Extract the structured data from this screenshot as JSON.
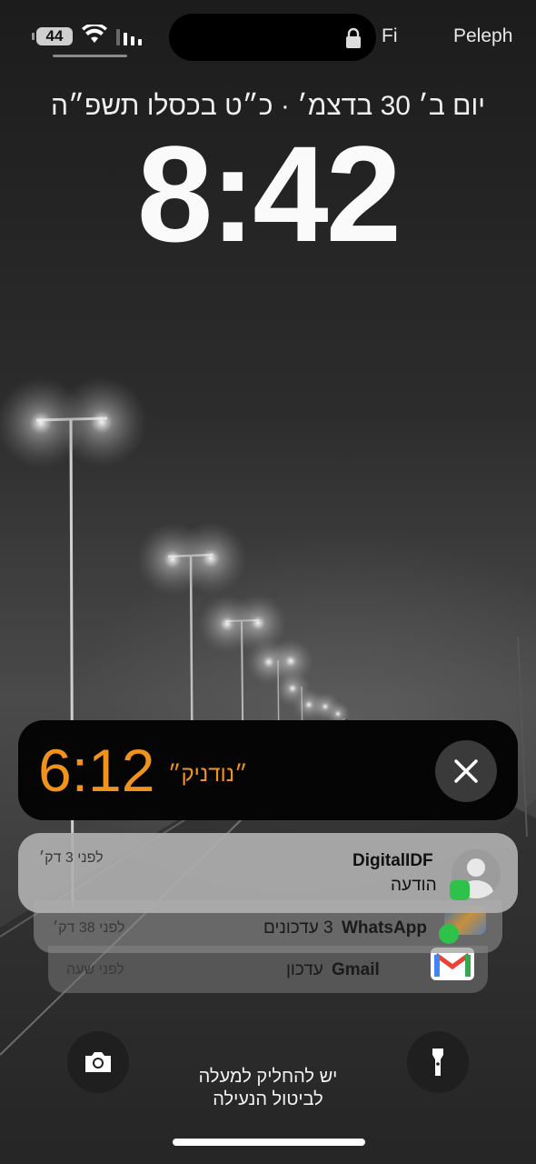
{
  "status_bar": {
    "battery": "44",
    "wifi_label": "Fi",
    "carrier": "Peleph"
  },
  "lock_screen": {
    "date": "יום ב׳ 30 בדצמ׳ · כ״ט בכסלו תשפ״ה",
    "time": "8:42"
  },
  "timer_activity": {
    "remaining": "6:12",
    "label": "״נודניק״",
    "accent_color": "#f0921e"
  },
  "notifications": [
    {
      "app": "DigitalIDF",
      "subtitle": "הודעה",
      "time": "לפני 3 דק׳",
      "icon": "contact-avatar",
      "badge": "messages-badge"
    },
    {
      "app": "WhatsApp",
      "text": "3 עדכונים",
      "time": "לפני 38 דק׳",
      "icon": "group-photo",
      "badge": "whatsapp-badge"
    },
    {
      "app": "Gmail",
      "text": "עדכון",
      "time": "לפני שעה",
      "icon": "gmail-icon"
    }
  ],
  "bottom": {
    "hint_line1": "יש להחליק למעלה",
    "hint_line2": "לביטול הנעילה"
  }
}
